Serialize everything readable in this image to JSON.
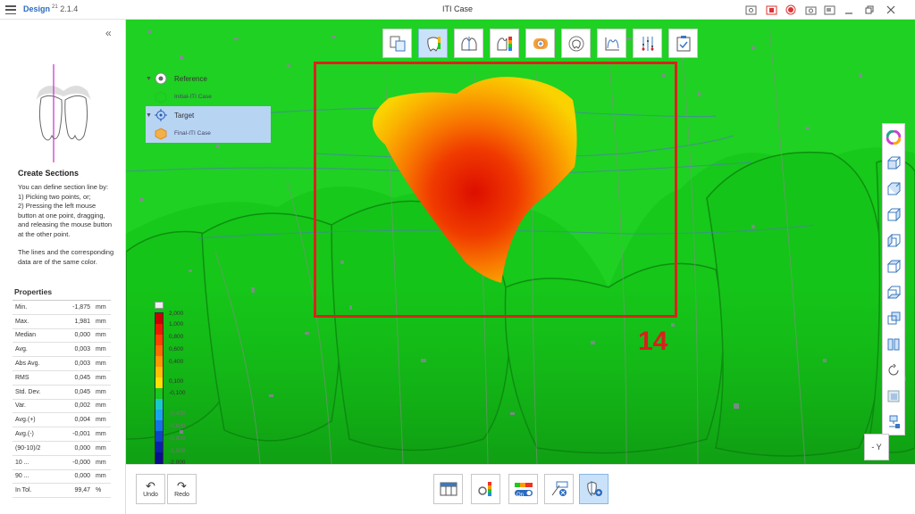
{
  "app": {
    "name": "Design",
    "version_sup": "21",
    "version": "2.1.4",
    "window_title": "ITI Case"
  },
  "titlebar_icons": [
    "screenshot-icon",
    "capture-icon",
    "record-icon",
    "camera-icon",
    "window-icon",
    "minimize-icon",
    "restore-icon",
    "close-icon"
  ],
  "left_panel": {
    "help_title": "Create Sections",
    "help_lines": [
      "You can define section line by:",
      "1) Picking two points, or;",
      "2) Pressing the left mouse button at one point, dragging, and releasing the mouse button at the other point."
    ],
    "help_note": "The lines and the corresponding data are of the same color.",
    "properties_title": "Properties",
    "properties": [
      {
        "label": "Min.",
        "value": "-1,875",
        "unit": "mm"
      },
      {
        "label": "Max.",
        "value": "1,981",
        "unit": "mm"
      },
      {
        "label": "Median",
        "value": "0,000",
        "unit": "mm"
      },
      {
        "label": "Avg.",
        "value": "0,003",
        "unit": "mm"
      },
      {
        "label": "Abs Avg.",
        "value": "0,003",
        "unit": "mm"
      },
      {
        "label": "RMS",
        "value": "0,045",
        "unit": "mm"
      },
      {
        "label": "Std. Dev.",
        "value": "0,045",
        "unit": "mm"
      },
      {
        "label": "Var.",
        "value": "0,002",
        "unit": "mm"
      },
      {
        "label": "Avg.(+)",
        "value": "0,004",
        "unit": "mm"
      },
      {
        "label": "Avg.(-)",
        "value": "-0,001",
        "unit": "mm"
      },
      {
        "label": "(90-10)/2",
        "value": "0,000",
        "unit": "mm"
      },
      {
        "label": "10 ...",
        "value": "-0,000",
        "unit": "mm"
      },
      {
        "label": "90 ...",
        "value": "0,000",
        "unit": "mm"
      },
      {
        "label": "In Tol.",
        "value": "99,47",
        "unit": "%"
      }
    ]
  },
  "layers": {
    "reference_label": "Reference",
    "reference_item": "Initial-ITI Case",
    "target_label": "Target",
    "target_item": "Final-ITI Case"
  },
  "colorbar": {
    "labels": [
      "2,000",
      "1,000",
      "0,800",
      "0,600",
      "0,400",
      "0,100",
      "-0,100",
      "-0,400",
      "-0,600",
      "-0,800",
      "-1,000",
      "-2,000"
    ],
    "colors": [
      "#cc0000",
      "#ee1a00",
      "#ff4000",
      "#ff6a00",
      "#ff9600",
      "#ffbf00",
      "#ffe000",
      "#18c81a",
      "#19c9c9",
      "#1aa3ee",
      "#1473e6",
      "#0c45c8",
      "#0a22a8",
      "#08108a"
    ]
  },
  "annotation": {
    "tooth_number": "14",
    "highlight_color": "#d9221d"
  },
  "view_label": "- Y",
  "toolbar_top": [
    "align-tool-icon",
    "tooth-select-icon",
    "section-tool-icon",
    "deviation-map-icon",
    "tooth-check-icon",
    "rotate-view-icon",
    "profile-icon",
    "measure-tools-icon",
    "checklist-icon"
  ],
  "toolbar_right": [
    "color-wheel-icon",
    "cube-view-1-icon",
    "cube-view-2-icon",
    "cube-view-3-icon",
    "cube-view-4-icon",
    "cube-view-5-icon",
    "cube-view-6-icon",
    "cube-view-7-icon",
    "split-view-icon",
    "reset-rotation-icon",
    "transparency-icon",
    "settings-view-icon"
  ],
  "bottom": {
    "undo_label": "Undo",
    "redo_label": "Redo",
    "toggle_label": "On",
    "tools": [
      "table-icon",
      "color-map-settings-icon",
      "toggle-on-icon",
      "remove-section-icon",
      "add-section-icon"
    ]
  }
}
